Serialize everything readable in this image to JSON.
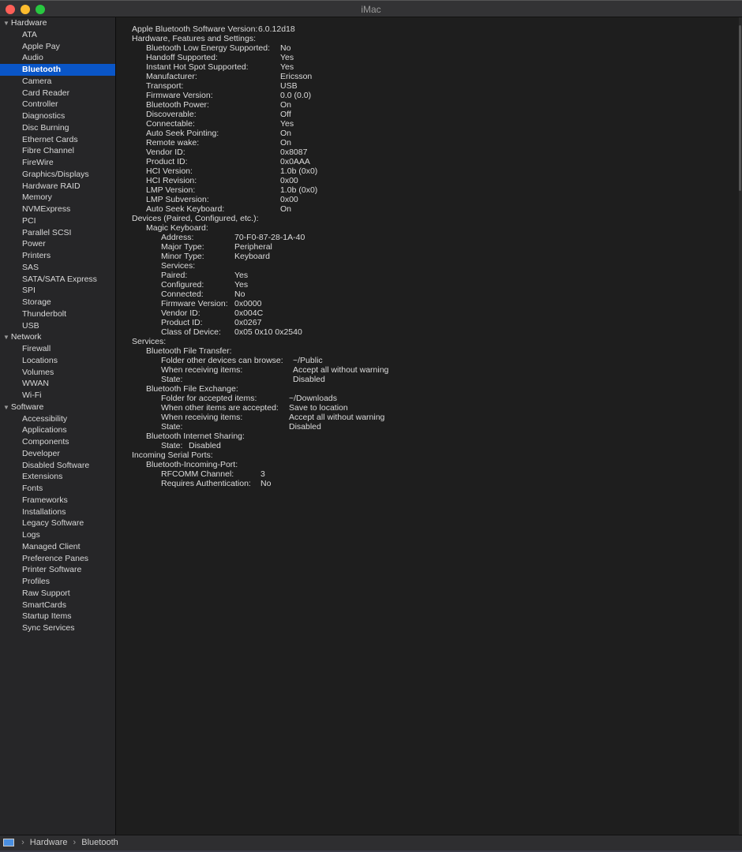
{
  "window": {
    "title": "iMac",
    "colors": {
      "close": "#fe5f57",
      "minimize": "#febc2e",
      "zoom": "#28c840",
      "selection": "#0a56c8"
    }
  },
  "sidebar": {
    "categories": [
      {
        "label": "Hardware",
        "items": [
          "ATA",
          "Apple Pay",
          "Audio",
          "Bluetooth",
          "Camera",
          "Card Reader",
          "Controller",
          "Diagnostics",
          "Disc Burning",
          "Ethernet Cards",
          "Fibre Channel",
          "FireWire",
          "Graphics/Displays",
          "Hardware RAID",
          "Memory",
          "NVMExpress",
          "PCI",
          "Parallel SCSI",
          "Power",
          "Printers",
          "SAS",
          "SATA/SATA Express",
          "SPI",
          "Storage",
          "Thunderbolt",
          "USB"
        ]
      },
      {
        "label": "Network",
        "items": [
          "Firewall",
          "Locations",
          "Volumes",
          "WWAN",
          "Wi-Fi"
        ]
      },
      {
        "label": "Software",
        "items": [
          "Accessibility",
          "Applications",
          "Components",
          "Developer",
          "Disabled Software",
          "Extensions",
          "Fonts",
          "Frameworks",
          "Installations",
          "Legacy Software",
          "Logs",
          "Managed Client",
          "Preference Panes",
          "Printer Software",
          "Profiles",
          "Raw Support",
          "SmartCards",
          "Startup Items",
          "Sync Services"
        ]
      }
    ],
    "selected": "Bluetooth"
  },
  "content": {
    "rows": [
      {
        "l": "Apple Bluetooth Software Version:",
        "v": "6.0.12d18",
        "i": 0,
        "g": "top"
      },
      {
        "l": "Hardware, Features and Settings:",
        "i": 0
      },
      {
        "l": "Bluetooth Low Energy Supported:",
        "v": "No",
        "i": 1,
        "g": "hw"
      },
      {
        "l": "Handoff Supported:",
        "v": "Yes",
        "i": 1,
        "g": "hw"
      },
      {
        "l": "Instant Hot Spot Supported:",
        "v": "Yes",
        "i": 1,
        "g": "hw"
      },
      {
        "l": "Manufacturer:",
        "v": "Ericsson",
        "i": 1,
        "g": "hw"
      },
      {
        "l": "Transport:",
        "v": "USB",
        "i": 1,
        "g": "hw"
      },
      {
        "l": "Firmware Version:",
        "v": "0.0 (0.0)",
        "i": 1,
        "g": "hw"
      },
      {
        "l": "Bluetooth Power:",
        "v": "On",
        "i": 1,
        "g": "hw"
      },
      {
        "l": "Discoverable:",
        "v": "Off",
        "i": 1,
        "g": "hw"
      },
      {
        "l": "Connectable:",
        "v": "Yes",
        "i": 1,
        "g": "hw"
      },
      {
        "l": "Auto Seek Pointing:",
        "v": "On",
        "i": 1,
        "g": "hw"
      },
      {
        "l": "Remote wake:",
        "v": "On",
        "i": 1,
        "g": "hw"
      },
      {
        "l": "Vendor ID:",
        "v": "0x8087",
        "i": 1,
        "g": "hw"
      },
      {
        "l": "Product ID:",
        "v": "0x0AAA",
        "i": 1,
        "g": "hw"
      },
      {
        "l": "HCI Version:",
        "v": "1.0b (0x0)",
        "i": 1,
        "g": "hw"
      },
      {
        "l": "HCI Revision:",
        "v": "0x00",
        "i": 1,
        "g": "hw"
      },
      {
        "l": "LMP Version:",
        "v": "1.0b (0x0)",
        "i": 1,
        "g": "hw"
      },
      {
        "l": "LMP Subversion:",
        "v": "0x00",
        "i": 1,
        "g": "hw"
      },
      {
        "l": "Auto Seek Keyboard:",
        "v": "On",
        "i": 1,
        "g": "hw"
      },
      {
        "l": "Devices (Paired, Configured, etc.):",
        "i": 0
      },
      {
        "l": "Magic Keyboard:",
        "i": 1
      },
      {
        "l": "Address:",
        "v": "70-F0-87-28-1A-40",
        "i": 2,
        "g": "dev"
      },
      {
        "l": "Major Type:",
        "v": "Peripheral",
        "i": 2,
        "g": "dev"
      },
      {
        "l": "Minor Type:",
        "v": "Keyboard",
        "i": 2,
        "g": "dev"
      },
      {
        "l": "Services:",
        "i": 2
      },
      {
        "l": "Paired:",
        "v": "Yes",
        "i": 2,
        "g": "dev"
      },
      {
        "l": "Configured:",
        "v": "Yes",
        "i": 2,
        "g": "dev"
      },
      {
        "l": "Connected:",
        "v": "No",
        "i": 2,
        "g": "dev"
      },
      {
        "l": "Firmware Version:",
        "v": "0x0000",
        "i": 2,
        "g": "dev"
      },
      {
        "l": "Vendor ID:",
        "v": "0x004C",
        "i": 2,
        "g": "dev"
      },
      {
        "l": "Product ID:",
        "v": "0x0267",
        "i": 2,
        "g": "dev"
      },
      {
        "l": "Class of Device:",
        "v": "0x05 0x10 0x2540",
        "i": 2,
        "g": "dev"
      },
      {
        "l": "Services:",
        "i": 0
      },
      {
        "l": "Bluetooth File Transfer:",
        "i": 1
      },
      {
        "l": "Folder other devices can browse:",
        "v": "~/Public",
        "i": 2,
        "g": "ft"
      },
      {
        "l": "When receiving items:",
        "v": "Accept all without warning",
        "i": 2,
        "g": "ft"
      },
      {
        "l": "State:",
        "v": "Disabled",
        "i": 2,
        "g": "ft"
      },
      {
        "l": "Bluetooth File Exchange:",
        "i": 1
      },
      {
        "l": "Folder for accepted items:",
        "v": "~/Downloads",
        "i": 2,
        "g": "fe"
      },
      {
        "l": "When other items are accepted:",
        "v": "Save to location",
        "i": 2,
        "g": "fe"
      },
      {
        "l": "When receiving items:",
        "v": "Accept all without warning",
        "i": 2,
        "g": "fe"
      },
      {
        "l": "State:",
        "v": "Disabled",
        "i": 2,
        "g": "fe"
      },
      {
        "l": "Bluetooth Internet Sharing:",
        "i": 1
      },
      {
        "l": "State:",
        "v": "Disabled",
        "i": 2,
        "g": "is"
      },
      {
        "l": "Incoming Serial Ports:",
        "i": 0
      },
      {
        "l": "Bluetooth-Incoming-Port:",
        "i": 1
      },
      {
        "l": "RFCOMM Channel:",
        "v": "3",
        "i": 2,
        "g": "sp"
      },
      {
        "l": "Requires Authentication:",
        "v": "No",
        "i": 2,
        "g": "sp"
      }
    ]
  },
  "pathbar": {
    "items": [
      "Hardware",
      "Bluetooth"
    ]
  }
}
